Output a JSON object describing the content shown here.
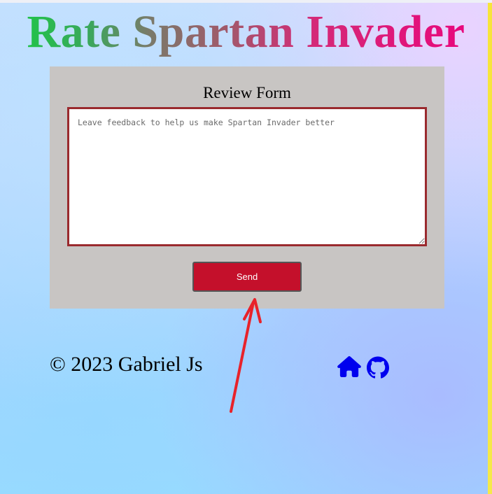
{
  "header": {
    "title": "Rate Spartan Invader"
  },
  "review_form": {
    "title": "Review Form",
    "feedback_placeholder": "Leave feedback to help us make Spartan Invader better",
    "feedback_value": "",
    "send_label": "Send"
  },
  "footer": {
    "copyright": "© 2023 Gabriel Js",
    "links": [
      {
        "icon": "home-icon",
        "color": "#0000ee"
      },
      {
        "icon": "github-icon",
        "color": "#0000ee"
      }
    ]
  },
  "annotation": {
    "arrow_color": "#e8222a"
  }
}
